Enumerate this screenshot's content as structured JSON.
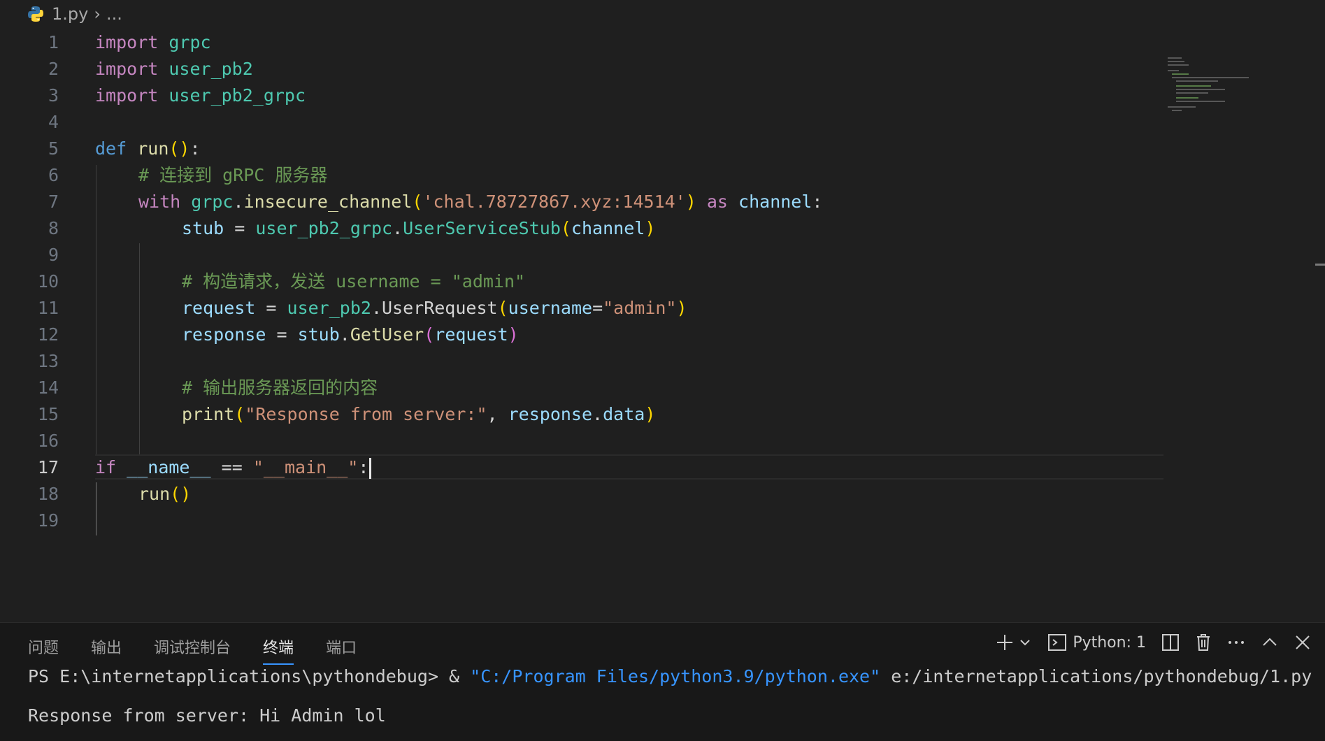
{
  "breadcrumb": {
    "file": "1.py",
    "rest": "..."
  },
  "editor": {
    "active_line": 17,
    "lines": [
      {
        "n": "1"
      },
      {
        "n": "2"
      },
      {
        "n": "3"
      },
      {
        "n": "4"
      },
      {
        "n": "5"
      },
      {
        "n": "6"
      },
      {
        "n": "7"
      },
      {
        "n": "8"
      },
      {
        "n": "9"
      },
      {
        "n": "10"
      },
      {
        "n": "11"
      },
      {
        "n": "12"
      },
      {
        "n": "13"
      },
      {
        "n": "14"
      },
      {
        "n": "15"
      },
      {
        "n": "16"
      },
      {
        "n": "17"
      },
      {
        "n": "18"
      },
      {
        "n": "19"
      }
    ],
    "tokens": {
      "l1": [
        "import",
        " grpc"
      ],
      "l2": [
        "import",
        " user_pb2"
      ],
      "l3": [
        "import",
        " user_pb2_grpc"
      ],
      "l5": [
        "def",
        " ",
        "run",
        "()",
        ":"
      ],
      "l6": [
        "# 连接到 gRPC 服务器"
      ],
      "l7": [
        "with",
        " ",
        "grpc",
        ".",
        "insecure_channel",
        "(",
        "'chal.78727867.xyz:14514'",
        ")",
        " ",
        "as",
        " ",
        "channel",
        ":"
      ],
      "l8": [
        "stub",
        " = ",
        "user_pb2_grpc",
        ".",
        "UserServiceStub",
        "(",
        "channel",
        ")"
      ],
      "l10": [
        "# 构造请求，发送 username = \"admin\""
      ],
      "l11": [
        "request",
        " = ",
        "user_pb2",
        ".",
        "UserRequest",
        "(",
        "username",
        "=",
        "\"admin\"",
        ")"
      ],
      "l12": [
        "response",
        " = ",
        "stub",
        ".",
        "GetUser",
        "(",
        "request",
        ")"
      ],
      "l14": [
        "# 输出服务器返回的内容"
      ],
      "l15": [
        "print",
        "(",
        "\"Response from server:\"",
        ", ",
        "response",
        ".",
        "data",
        ")"
      ],
      "l17": [
        "if",
        " ",
        "__name__",
        " == ",
        "\"__main__\"",
        ":"
      ],
      "l18": [
        "run",
        "()"
      ]
    }
  },
  "panel": {
    "tabs": [
      "问题",
      "输出",
      "调试控制台",
      "终端",
      "端口"
    ],
    "active_tab": "终端",
    "terminal_label": "Python: 1",
    "terminal": {
      "prompt": "PS E:\\internetapplications\\pythondebug> & ",
      "exe": "\"C:/Program Files/python3.9/python.exe\"",
      "arg": " e:/internetapplications/pythondebug/1.py",
      "output": "Response from server: Hi Admin lol"
    }
  },
  "icons": {
    "python": "python-file-icon",
    "add": "plus-icon",
    "dropdown": "chevron-down-icon",
    "terminal": "terminal-icon",
    "split": "split-icon",
    "trash": "trash-icon",
    "more": "more-icon",
    "maximize": "chevron-up-icon",
    "close": "close-icon"
  }
}
